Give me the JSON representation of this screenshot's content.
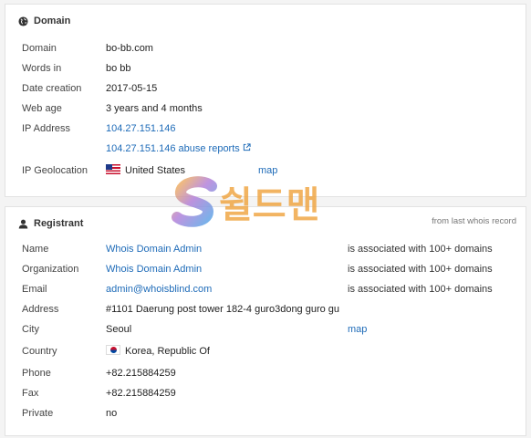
{
  "domain": {
    "title": "Domain",
    "rows": {
      "domain": {
        "label": "Domain",
        "value": "bo-bb.com"
      },
      "words": {
        "label": "Words in",
        "value": "bo bb"
      },
      "created": {
        "label": "Date creation",
        "value": "2017-05-15"
      },
      "age": {
        "label": "Web age",
        "value": "3 years and 4 months"
      },
      "ip": {
        "label": "IP Address",
        "value": "104.27.151.146"
      },
      "abuse": {
        "value": "104.27.151.146 abuse reports"
      },
      "geo": {
        "label": "IP Geolocation",
        "value": "United States",
        "map": "map"
      }
    }
  },
  "registrant": {
    "title": "Registrant",
    "note": "from last whois record",
    "rows": {
      "name": {
        "label": "Name",
        "value": "Whois Domain Admin",
        "assoc": "is associated with 100+ domains"
      },
      "org": {
        "label": "Organization",
        "value": "Whois Domain Admin",
        "assoc": "is associated with 100+ domains"
      },
      "email": {
        "label": "Email",
        "value": "admin@whoisblind.com",
        "assoc": "is associated with 100+ domains"
      },
      "address": {
        "label": "Address",
        "value": "#1101 Daerung post tower 182-4 guro3dong guro gu"
      },
      "city": {
        "label": "City",
        "value": "Seoul",
        "map": "map"
      },
      "country": {
        "label": "Country",
        "value": "Korea, Republic Of"
      },
      "phone": {
        "label": "Phone",
        "value": "+82.215884259"
      },
      "fax": {
        "label": "Fax",
        "value": "+82.215884259"
      },
      "private": {
        "label": "Private",
        "value": "no"
      }
    }
  },
  "watermark": {
    "text": "S쉴드맨"
  },
  "icons": {
    "domain": "globe-icon",
    "registrant": "user-icon",
    "external": "external-link-icon"
  },
  "colors": {
    "link": "#1e6bb8",
    "text": "#333333",
    "border": "#e2e2e2"
  }
}
